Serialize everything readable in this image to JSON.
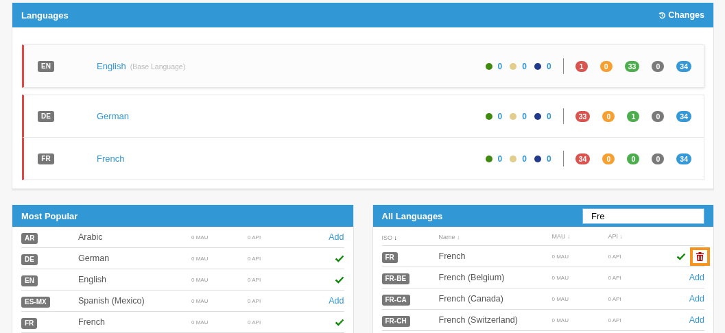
{
  "languages_panel": {
    "title": "Languages",
    "changes_button": "Changes",
    "rows": [
      {
        "iso": "EN",
        "name": "English",
        "note": "(Base Language)",
        "raised": true,
        "dots": [
          {
            "color": "#3f8a0f",
            "count": "0"
          },
          {
            "color": "#e2cd8c",
            "count": "0"
          },
          {
            "color": "#223a8c",
            "count": "0"
          }
        ],
        "pills": [
          {
            "color": "#d9534f",
            "count": "1"
          },
          {
            "color": "#f5a031",
            "count": "0"
          },
          {
            "color": "#4cae4c",
            "count": "33"
          },
          {
            "color": "#7a7a7a",
            "count": "0"
          },
          {
            "color": "#3598d7",
            "count": "34"
          }
        ]
      },
      {
        "iso": "DE",
        "name": "German",
        "raised": false,
        "dots": [
          {
            "color": "#3f8a0f",
            "count": "0"
          },
          {
            "color": "#e2cd8c",
            "count": "0"
          },
          {
            "color": "#223a8c",
            "count": "0"
          }
        ],
        "pills": [
          {
            "color": "#d9534f",
            "count": "33"
          },
          {
            "color": "#f5a031",
            "count": "0"
          },
          {
            "color": "#4cae4c",
            "count": "1"
          },
          {
            "color": "#7a7a7a",
            "count": "0"
          },
          {
            "color": "#3598d7",
            "count": "34"
          }
        ]
      },
      {
        "iso": "FR",
        "name": "French",
        "raised": false,
        "dots": [
          {
            "color": "#3f8a0f",
            "count": "0"
          },
          {
            "color": "#e2cd8c",
            "count": "0"
          },
          {
            "color": "#223a8c",
            "count": "0"
          }
        ],
        "pills": [
          {
            "color": "#d9534f",
            "count": "34"
          },
          {
            "color": "#f5a031",
            "count": "0"
          },
          {
            "color": "#4cae4c",
            "count": "0"
          },
          {
            "color": "#7a7a7a",
            "count": "0"
          },
          {
            "color": "#3598d7",
            "count": "34"
          }
        ]
      }
    ]
  },
  "most_popular": {
    "title": "Most Popular",
    "rows": [
      {
        "iso": "AR",
        "name": "Arabic",
        "mau": "0 MAU",
        "api": "0 API",
        "added": false,
        "action": "Add"
      },
      {
        "iso": "DE",
        "name": "German",
        "mau": "0 MAU",
        "api": "0 API",
        "added": true
      },
      {
        "iso": "EN",
        "name": "English",
        "mau": "0 MAU",
        "api": "0 API",
        "added": true
      },
      {
        "iso": "ES-MX",
        "name": "Spanish (Mexico)",
        "mau": "0 MAU",
        "api": "0 API",
        "added": false,
        "action": "Add"
      },
      {
        "iso": "FR",
        "name": "French",
        "mau": "0 MAU",
        "api": "0 API",
        "added": true
      }
    ]
  },
  "all_languages": {
    "title": "All Languages",
    "search_value": "Fre",
    "columns": [
      {
        "label": "ISO",
        "arrow": "↓",
        "sorted": true
      },
      {
        "label": "Name",
        "arrow": "↓",
        "sorted": false
      },
      {
        "label": "MAU",
        "arrow": "↓",
        "sorted": false
      },
      {
        "label": "API",
        "arrow": "↓",
        "sorted": false
      }
    ],
    "rows": [
      {
        "iso": "FR",
        "name": "French",
        "mau": "0 MAU",
        "api": "0 API",
        "added": true,
        "highlighted": true
      },
      {
        "iso": "FR-BE",
        "name": "French (Belgium)",
        "mau": "0 MAU",
        "api": "0 API",
        "added": false,
        "action": "Add"
      },
      {
        "iso": "FR-CA",
        "name": "French (Canada)",
        "mau": "0 MAU",
        "api": "0 API",
        "added": false,
        "action": "Add"
      },
      {
        "iso": "FR-CH",
        "name": "French (Switzerland)",
        "mau": "0 MAU",
        "api": "0 API",
        "added": false,
        "action": "Add"
      }
    ]
  }
}
